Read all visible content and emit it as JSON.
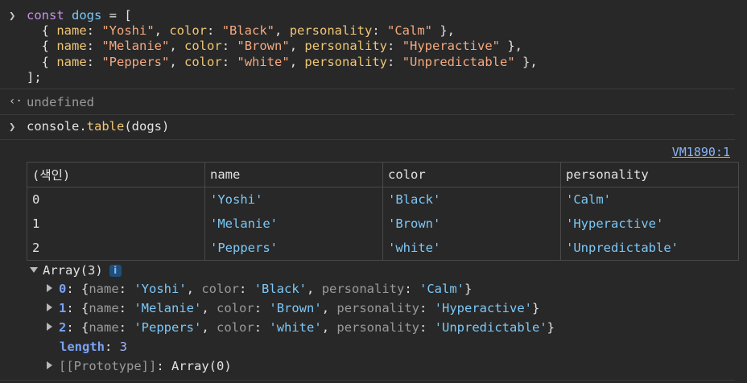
{
  "input1": {
    "prompt_icon": "chevron-right-icon",
    "kw": "const",
    "var": "dogs",
    "eq": " = [",
    "rows": [
      {
        "name": "\"Yoshi\"",
        "color": "\"Black\"",
        "personality": "\"Calm\""
      },
      {
        "name": "\"Melanie\"",
        "color": "\"Brown\"",
        "personality": "\"Hyperactive\""
      },
      {
        "name": "\"Peppers\"",
        "color": "\"white\"",
        "personality": "\"Unpredictable\""
      }
    ],
    "close": "];"
  },
  "result1": {
    "icon": "return-arrow-icon",
    "text": "undefined"
  },
  "input2": {
    "prompt_icon": "chevron-right-icon",
    "obj": "console",
    "dot": ".",
    "fn": "table",
    "args": "(dogs)"
  },
  "source_link": "VM1890:1",
  "table": {
    "headers": [
      "(색인)",
      "name",
      "color",
      "personality"
    ],
    "rows": [
      [
        "0",
        "'Yoshi'",
        "'Black'",
        "'Calm'"
      ],
      [
        "1",
        "'Melanie'",
        "'Brown'",
        "'Hyperactive'"
      ],
      [
        "2",
        "'Peppers'",
        "'white'",
        "'Unpredictable'"
      ]
    ]
  },
  "tree": {
    "label": "Array(3)",
    "info_badge": "i",
    "items": [
      {
        "index": "0",
        "name": "'Yoshi'",
        "color": "'Black'",
        "personality": "'Calm'"
      },
      {
        "index": "1",
        "name": "'Melanie'",
        "color": "'Brown'",
        "personality": "'Hyperactive'"
      },
      {
        "index": "2",
        "name": "'Peppers'",
        "color": "'white'",
        "personality": "'Unpredictable'"
      }
    ],
    "length_key": "length",
    "length_value": "3",
    "prototype_key": "[[Prototype]]",
    "prototype_value": "Array(0)"
  },
  "labels": {
    "name_key": "name",
    "color_key": "color",
    "personality_key": "personality"
  }
}
